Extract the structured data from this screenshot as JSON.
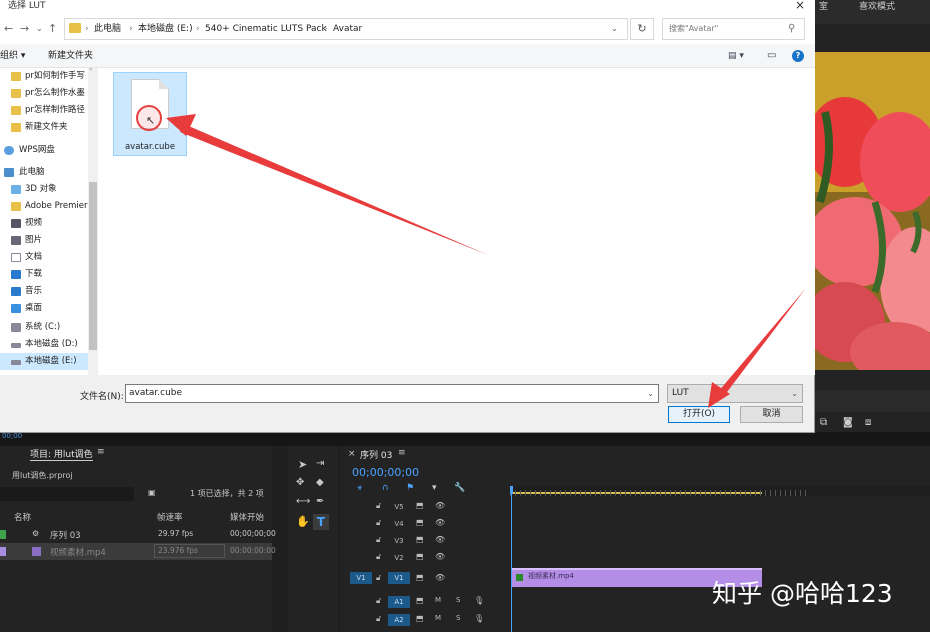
{
  "dialog": {
    "title": "选择 LUT",
    "breadcrumb": [
      "此电脑",
      "本地磁盘 (E:)",
      "540+ Cinematic LUTS Pack",
      "Avatar"
    ],
    "search_placeholder": "搜索\"Avatar\"",
    "toolbar": {
      "organize": "组织 ▾",
      "new_folder": "新建文件夹"
    },
    "nav_items": [
      {
        "label": "pr如何制作手写",
        "icon": "folder-icon"
      },
      {
        "label": "pr怎么制作水墨",
        "icon": "folder-icon"
      },
      {
        "label": "pr怎样制作路径",
        "icon": "folder-icon"
      },
      {
        "label": "新建文件夹",
        "icon": "folder-icon"
      },
      {
        "label": "WPS网盘",
        "icon": "cloud-icon"
      },
      {
        "label": "此电脑",
        "icon": "computer-icon"
      },
      {
        "label": "3D 对象",
        "icon": "cube-icon"
      },
      {
        "label": "Adobe Premier",
        "icon": "folder-icon"
      },
      {
        "label": "视频",
        "icon": "video-icon"
      },
      {
        "label": "图片",
        "icon": "picture-icon"
      },
      {
        "label": "文档",
        "icon": "document-icon"
      },
      {
        "label": "下载",
        "icon": "download-icon"
      },
      {
        "label": "音乐",
        "icon": "music-icon"
      },
      {
        "label": "桌面",
        "icon": "desktop-icon"
      },
      {
        "label": "系统 (C:)",
        "icon": "drive-icon"
      },
      {
        "label": "本地磁盘 (D:)",
        "icon": "drive-icon"
      },
      {
        "label": "本地磁盘 (E:)",
        "icon": "drive-icon"
      }
    ],
    "file": {
      "name": "avatar.cube"
    },
    "filename_label": "文件名(N):",
    "filename_value": "avatar.cube",
    "filter_value": "LUT",
    "open_label": "打开(O)",
    "cancel_label": "取消"
  },
  "premiere": {
    "topbar": [
      "室",
      "喜欢模式"
    ],
    "project": {
      "tab": "项目: 用lut调色",
      "file": "用lut调色.prproj",
      "selection": "1 项已选择，共 2 项",
      "columns": [
        "名称",
        "帧速率",
        "媒体开始"
      ],
      "rows": [
        {
          "name": "序列 03",
          "fps": "29.97 fps",
          "start": "00;00;00;00",
          "color": "#3fa34d"
        },
        {
          "name": "视频素材.mp4",
          "fps": "23.976 fps",
          "start": "00:00:00:00",
          "color": "#a98de0"
        }
      ]
    },
    "timecode_small": "00;00",
    "sequence_tab": "序列 03",
    "timecode": "00;00;00;00",
    "tracks": [
      "V5",
      "V4",
      "V3",
      "V2",
      "V1",
      "A1",
      "A2"
    ],
    "source_patch": [
      "V1"
    ],
    "clip_name": "视频素材.mp4",
    "clip_color": "#b48ee6",
    "audio_buttons": [
      "M",
      "S"
    ]
  },
  "watermark": "知乎 @哈哈123"
}
